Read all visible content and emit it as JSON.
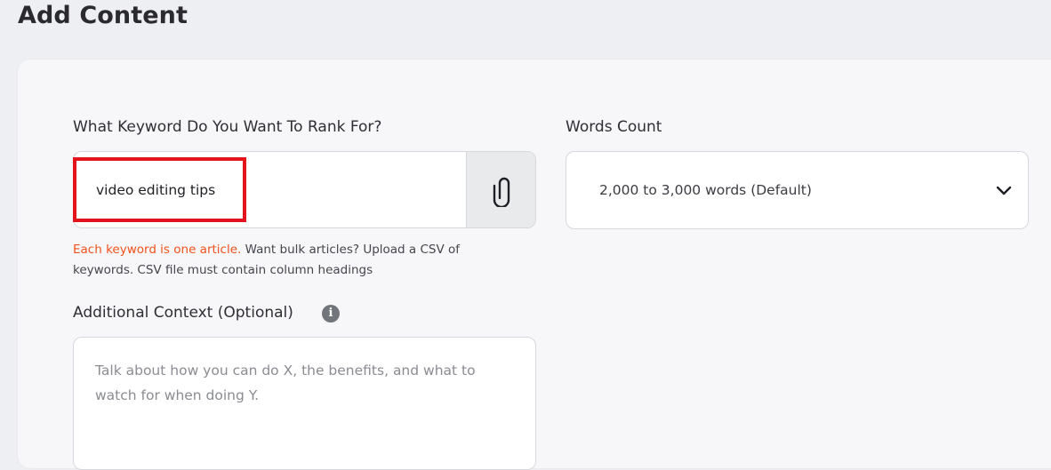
{
  "page": {
    "title": "Add Content"
  },
  "keyword": {
    "label": "What Keyword Do You Want To Rank For?",
    "value": "video editing tips",
    "attach_icon": "paperclip-icon",
    "helper_accent": "Each keyword is one article.",
    "helper_rest": " Want bulk articles? Upload a CSV of keywords. CSV file must contain column headings"
  },
  "context": {
    "label": "Additional Context (Optional)",
    "info_icon_glyph": "i",
    "placeholder": "Talk about how you can do X, the benefits, and what to watch for when doing Y.",
    "value": ""
  },
  "words_count": {
    "label": "Words Count",
    "selected": "2,000 to 3,000 words (Default)",
    "chevron_icon": "chevron-down-icon"
  },
  "colors": {
    "accent_orange": "#f1511b",
    "highlight_red": "#e3141b",
    "background": "#eeeff2",
    "card": "#f7f7f9"
  }
}
